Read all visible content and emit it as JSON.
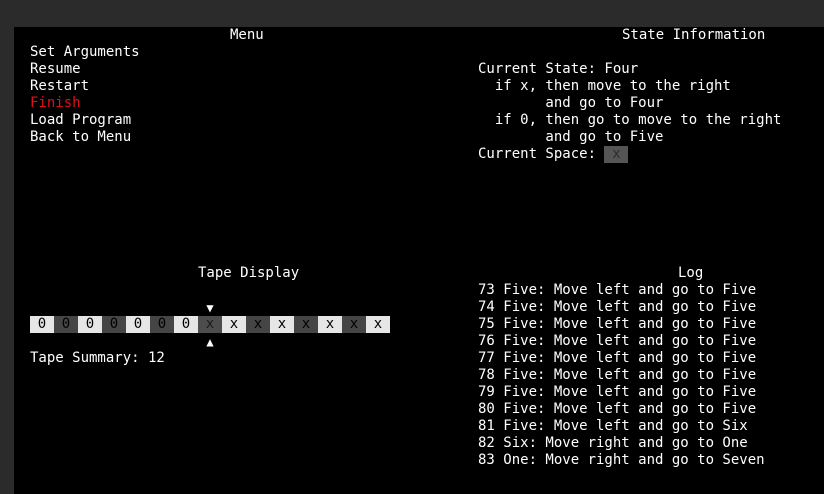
{
  "menu": {
    "title": "Menu",
    "items": [
      {
        "label": "Set Arguments",
        "selected": false
      },
      {
        "label": "Resume",
        "selected": false
      },
      {
        "label": "Restart",
        "selected": false
      },
      {
        "label": "Finish",
        "selected": true
      },
      {
        "label": "Load Program",
        "selected": false
      },
      {
        "label": "Back to Menu",
        "selected": false
      }
    ]
  },
  "state_info": {
    "title": "State Information",
    "current_state": "Current State: Four",
    "rules": [
      "  if x, then move to the right",
      "        and go to Four",
      "  if 0, then go to move to the right",
      "        and go to Five"
    ],
    "current_space_label": "Current Space: ",
    "current_space_value": "x"
  },
  "tape": {
    "title": "Tape Display",
    "cells": [
      "0",
      "0",
      "0",
      "0",
      "0",
      "0",
      "0",
      "x",
      "x",
      "x",
      "x",
      "x",
      "x",
      "x",
      "x"
    ],
    "shades": [
      "light",
      "dark",
      "light",
      "dark",
      "light",
      "dark",
      "light",
      "dark",
      "light",
      "dark",
      "light",
      "dark",
      "light",
      "dark",
      "light"
    ],
    "head_index": 7,
    "marker_top": "▼",
    "marker_bottom": "▲",
    "summary": "Tape Summary: 12"
  },
  "log": {
    "title": "Log",
    "entries": [
      "73 Five: Move left and go to Five",
      "74 Five: Move left and go to Five",
      "75 Five: Move left and go to Five",
      "76 Five: Move left and go to Five",
      "77 Five: Move left and go to Five",
      "78 Five: Move left and go to Five",
      "79 Five: Move left and go to Five",
      "80 Five: Move left and go to Five",
      "81 Five: Move left and go to Six",
      "82 Six: Move right and go to One",
      "83 One: Move right and go to Seven"
    ]
  },
  "colors": {
    "background": "#000000",
    "text": "#ffffff",
    "selected": "#e0101a",
    "frame": "#2b2b2b"
  }
}
